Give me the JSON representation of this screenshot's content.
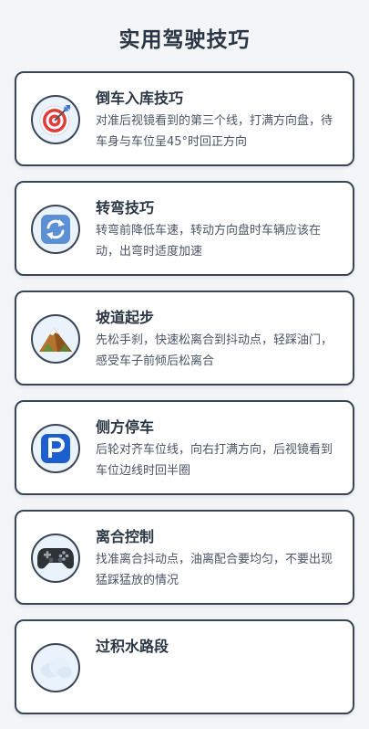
{
  "header": {
    "title": "实用驾驶技巧"
  },
  "tips": [
    {
      "title": "倒车入库技巧",
      "desc": "对准后视镜看到的第三个线，打满方向盘，待车身与车位呈45°时回正方向",
      "icon": "target-dart-icon"
    },
    {
      "title": "转弯技巧",
      "desc": "转弯前降低车速，转动方向盘时车辆应该在动，出弯时适度加速",
      "icon": "rotate-arrows-icon"
    },
    {
      "title": "坡道起步",
      "desc": "先松手刹，快速松离合到抖动点，轻踩油门，感受车子前倾后松离合",
      "icon": "mountain-icon"
    },
    {
      "title": "侧方停车",
      "desc": "后轮对齐车位线，向右打满方向，后视镜看到车位边线时回半圈",
      "icon": "parking-p-icon"
    },
    {
      "title": "离合控制",
      "desc": "找准离合抖动点，油离配合要均匀，不要出现猛踩猛放的情况",
      "icon": "gamepad-icon"
    },
    {
      "title": "过积水路段",
      "desc": "",
      "icon": "cloud-water-icon"
    }
  ],
  "colors": {
    "background": "#f3f5f8",
    "card_border": "#3a4656",
    "icon_circle_bg": "#eaf2fb",
    "parking_blue": "#1b5fd0",
    "rotate_blue": "#5b8fd6"
  }
}
